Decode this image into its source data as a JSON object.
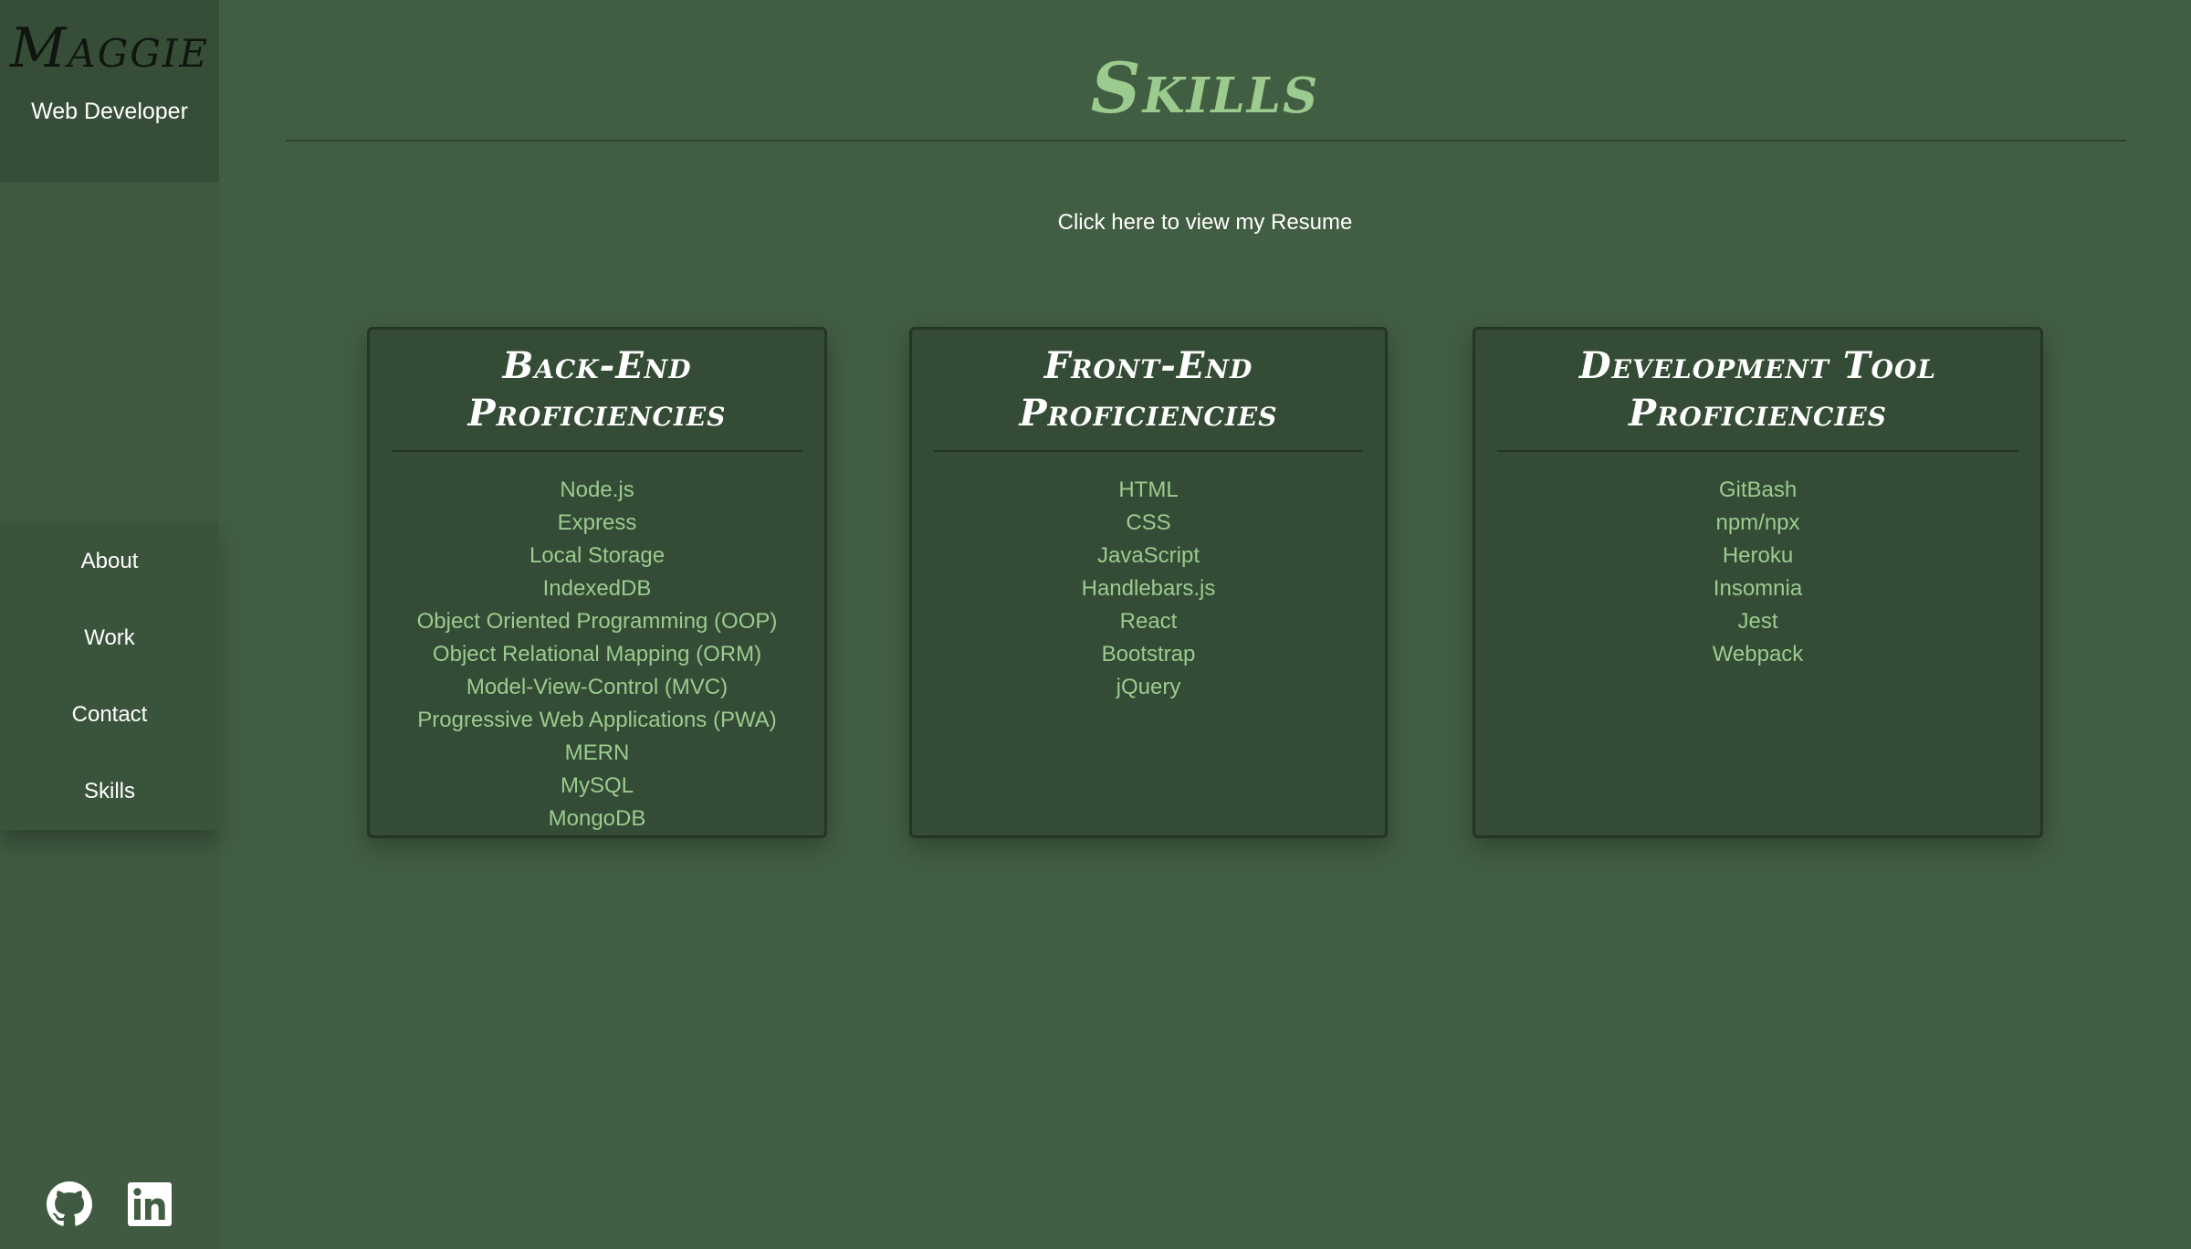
{
  "brand": {
    "name": "Maggie",
    "title": "Web Developer"
  },
  "nav": {
    "items": [
      {
        "label": "About"
      },
      {
        "label": "Work"
      },
      {
        "label": "Contact"
      },
      {
        "label": "Skills"
      }
    ]
  },
  "socials": [
    {
      "icon": "github-icon"
    },
    {
      "icon": "linkedin-icon"
    }
  ],
  "main": {
    "title": "Skills",
    "resume_link": "Click here to view my Resume"
  },
  "cards": [
    {
      "title": "Back-End Proficiencies",
      "skills": [
        "Node.js",
        "Express",
        "Local Storage",
        "IndexedDB",
        "Object Oriented Programming (OOP)",
        "Object Relational Mapping (ORM)",
        "Model-View-Control (MVC)",
        "Progressive Web Applications (PWA)",
        "MERN",
        "MySQL",
        "MongoDB"
      ]
    },
    {
      "title": "Front-End Proficiencies",
      "skills": [
        "HTML",
        "CSS",
        "JavaScript",
        "Handlebars.js",
        "React",
        "Bootstrap",
        "jQuery"
      ]
    },
    {
      "title": "Development Tool Proficiencies",
      "skills": [
        "GitBash",
        "npm/npx",
        "Heroku",
        "Insomnia",
        "Jest",
        "Webpack"
      ]
    }
  ],
  "colors": {
    "background": "#425e42",
    "accent": "#9ccb8f",
    "card": "#344b35"
  }
}
